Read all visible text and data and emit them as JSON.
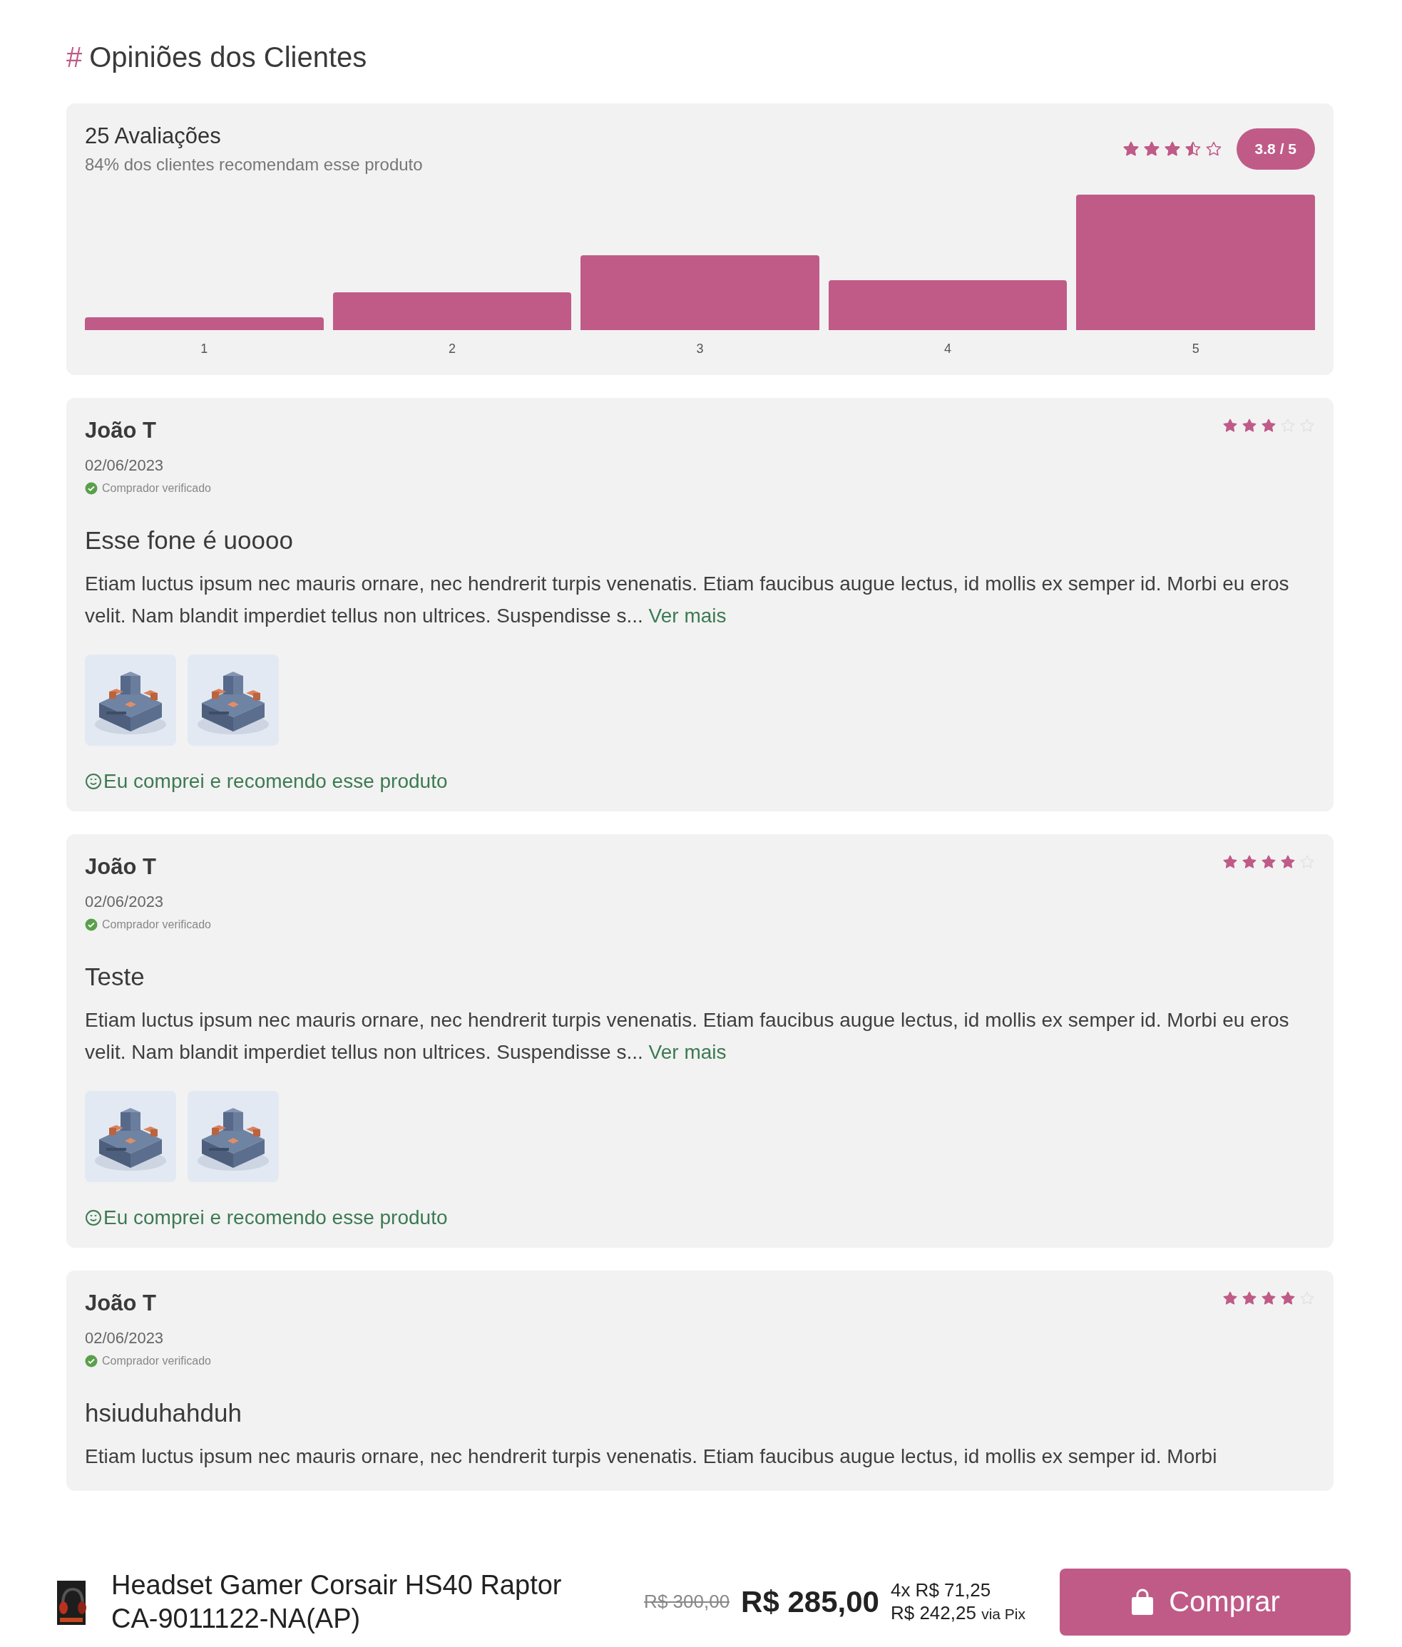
{
  "section_title": {
    "hash": "#",
    "text": "Opiniões dos Clientes"
  },
  "summary": {
    "count": "25 Avaliações",
    "recommend": "84% dos clientes recomendam esse produto",
    "stars": 3.5,
    "badge": "3.8 / 5",
    "histogram_labels": [
      "1",
      "2",
      "3",
      "4",
      "5"
    ]
  },
  "reviews": [
    {
      "name": "João T",
      "date": "02/06/2023",
      "verified": "Comprador verificado",
      "stars": 3,
      "title": "Esse fone é uoooo",
      "body": "Etiam luctus ipsum nec mauris ornare, nec hendrerit turpis venenatis. Etiam faucibus augue lectus, id mollis ex semper id. Morbi eu eros velit. Nam blandit imperdiet tellus non ultrices. Suspendisse s...",
      "more": "Ver mais",
      "photos": [
        {
          "kind": "picture"
        },
        {
          "kind": "picture"
        }
      ],
      "recommend": "Eu comprei e recomendo esse produto"
    },
    {
      "name": "João T",
      "date": "02/06/2023",
      "verified": "Comprador verificado",
      "stars": 4,
      "title": "Teste",
      "body": "Etiam luctus ipsum nec mauris ornare, nec hendrerit turpis venenatis. Etiam faucibus augue lectus, id mollis ex semper id. Morbi eu eros velit. Nam blandit imperdiet tellus non ultrices. Suspendisse s...",
      "more": "Ver mais",
      "photos": [
        {
          "kind": "picture"
        },
        {
          "kind": "picture"
        }
      ],
      "recommend": "Eu comprei e recomendo esse produto"
    },
    {
      "name": "João T",
      "date": "02/06/2023",
      "verified": "Comprador verificado",
      "stars": 4,
      "title": "hsiuduhahduh",
      "body": "Etiam luctus ipsum nec mauris ornare, nec hendrerit turpis venenatis. Etiam faucibus augue lectus, id mollis ex semper id. Morbi"
    }
  ],
  "bottom_bar": {
    "product": "Headset Gamer Corsair HS40 Raptor CA-9011122-NA(AP)",
    "old_price": "R$ 300,00",
    "price": "R$ 285,00",
    "installments": "4x R$ 71,25",
    "pix_price": "R$ 242,25",
    "pix_label": "via Pix",
    "buy": "Comprar"
  }
}
